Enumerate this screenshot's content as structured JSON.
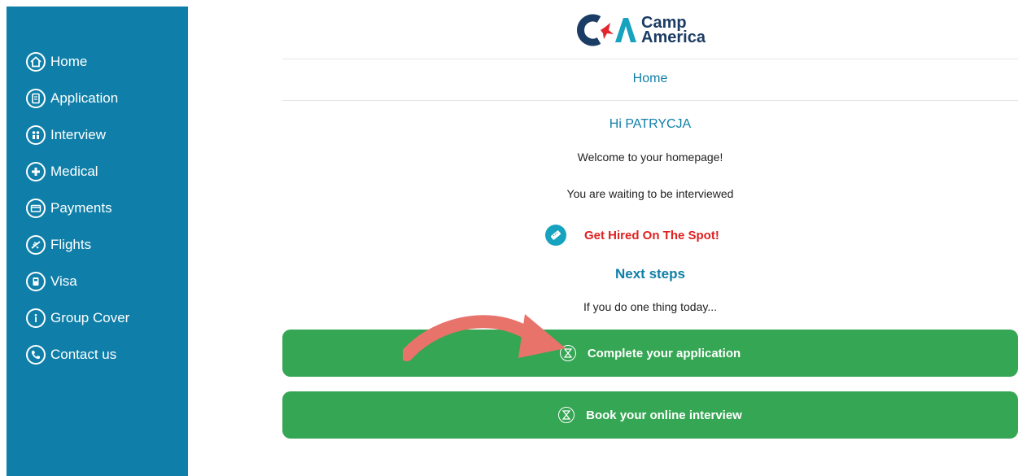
{
  "sidebar": {
    "items": [
      {
        "label": "Home",
        "icon": "home-icon"
      },
      {
        "label": "Application",
        "icon": "application-icon"
      },
      {
        "label": "Interview",
        "icon": "interview-icon"
      },
      {
        "label": "Medical",
        "icon": "medical-plus-icon"
      },
      {
        "label": "Payments",
        "icon": "payment-card-icon"
      },
      {
        "label": "Flights",
        "icon": "airplane-icon"
      },
      {
        "label": "Visa",
        "icon": "visa-document-icon"
      },
      {
        "label": "Group Cover",
        "icon": "info-icon"
      },
      {
        "label": "Contact us",
        "icon": "phone-icon"
      }
    ]
  },
  "logo": {
    "line1": "Camp",
    "line2": "America"
  },
  "header": {
    "title": "Home"
  },
  "main": {
    "greeting": "Hi PATRYCJA",
    "welcome": "Welcome to your homepage!",
    "status": "You are waiting to be interviewed",
    "promo_link": "Get Hired On The Spot!",
    "next_steps_heading": "Next steps",
    "next_steps_sub": "If you do one thing today...",
    "primary_action": "Complete your application",
    "secondary_action": "Book your online interview"
  },
  "colors": {
    "sidebar": "#0f7fa9",
    "accent_text": "#0f7fa9",
    "button": "#35a653",
    "promo": "#e02020",
    "annotation_arrow": "#e8736b"
  }
}
